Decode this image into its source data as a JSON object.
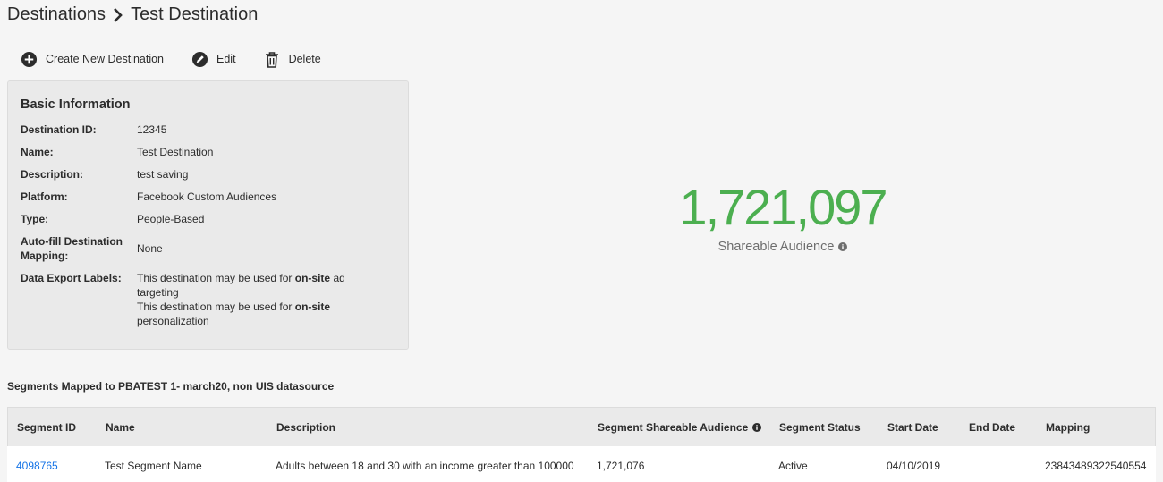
{
  "breadcrumb": {
    "parent": "Destinations",
    "current": "Test Destination"
  },
  "toolbar": {
    "create_label": "Create New Destination",
    "edit_label": "Edit",
    "delete_label": "Delete"
  },
  "basic_info": {
    "title": "Basic Information",
    "rows": [
      {
        "label": "Destination ID:",
        "value": "12345"
      },
      {
        "label": "Name:",
        "value": "Test Destination"
      },
      {
        "label": "Description:",
        "value": "test saving"
      },
      {
        "label": "Platform:",
        "value": "Facebook Custom Audiences"
      },
      {
        "label": "Type:",
        "value": "People-Based"
      },
      {
        "label": "Auto-fill Destination Mapping:",
        "value": "None"
      }
    ],
    "export_label": "Data Export Labels:",
    "export_lines": [
      {
        "prefix": "This destination may be used for ",
        "bold": "on-site",
        "suffix": " ad targeting"
      },
      {
        "prefix": "This destination may be used for ",
        "bold": "on-site",
        "suffix": " personalization"
      }
    ]
  },
  "stats": {
    "value": "1,721,097",
    "label": "Shareable Audience",
    "value_color": "#4caf50"
  },
  "segments": {
    "heading": "Segments Mapped to PBATEST 1- march20, non UIS datasource",
    "columns": [
      "Segment ID",
      "Name",
      "Description",
      "Segment Shareable Audience",
      "Segment Status",
      "Start Date",
      "End Date",
      "Mapping"
    ],
    "rows": [
      [
        "4098765",
        "Test Segment Name",
        "Adults between 18 and 30 with an income greater than 100000",
        "1,721,076",
        "Active",
        "04/10/2019",
        "",
        "23843489322540554"
      ]
    ]
  },
  "colors": {
    "link": "#1473e6",
    "accent_green": "#4caf50"
  }
}
